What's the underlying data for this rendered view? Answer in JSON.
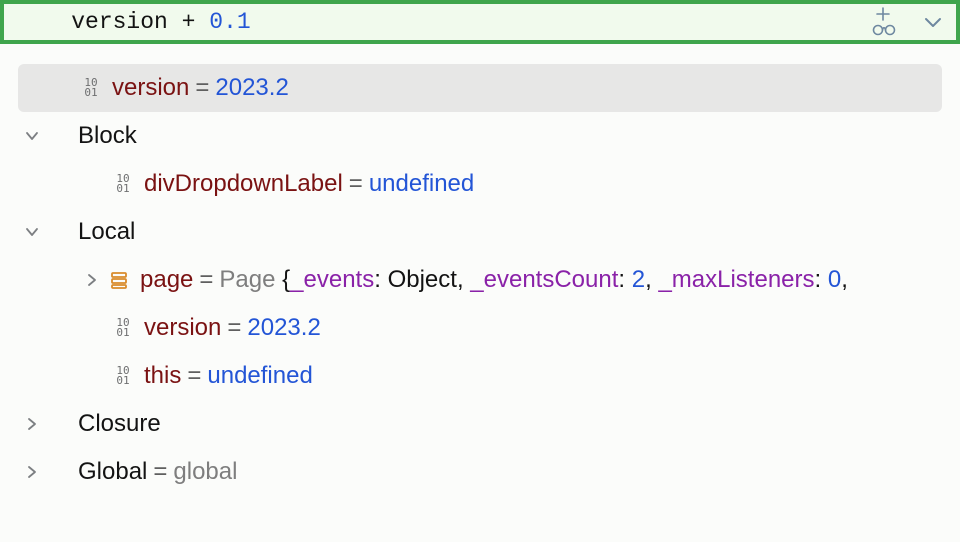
{
  "eval": {
    "lhs": "version",
    "op": "+",
    "rhs": "0.1"
  },
  "result": {
    "name": "version",
    "value": "2023.2"
  },
  "scopes": {
    "block": {
      "label": "Block",
      "items": [
        {
          "name": "divDropdownLabel",
          "value": "undefined",
          "type": "undefined"
        }
      ]
    },
    "local": {
      "label": "Local",
      "page": {
        "name": "page",
        "class": "Page",
        "props": [
          {
            "key": "_events",
            "value": "Object"
          },
          {
            "key": "_eventsCount",
            "value": "2"
          },
          {
            "key": "_maxListeners",
            "value": "0"
          }
        ],
        "trailing": ","
      },
      "version": {
        "name": "version",
        "value": "2023.2"
      },
      "this": {
        "name": "this",
        "value": "undefined"
      }
    },
    "closure": {
      "label": "Closure"
    },
    "global": {
      "label": "Global",
      "value": "global"
    }
  },
  "glyphs": {
    "prim": "10\n01",
    "brace_open": " {",
    "colon": ": ",
    "comma_sp": ", ",
    "eq": "="
  }
}
